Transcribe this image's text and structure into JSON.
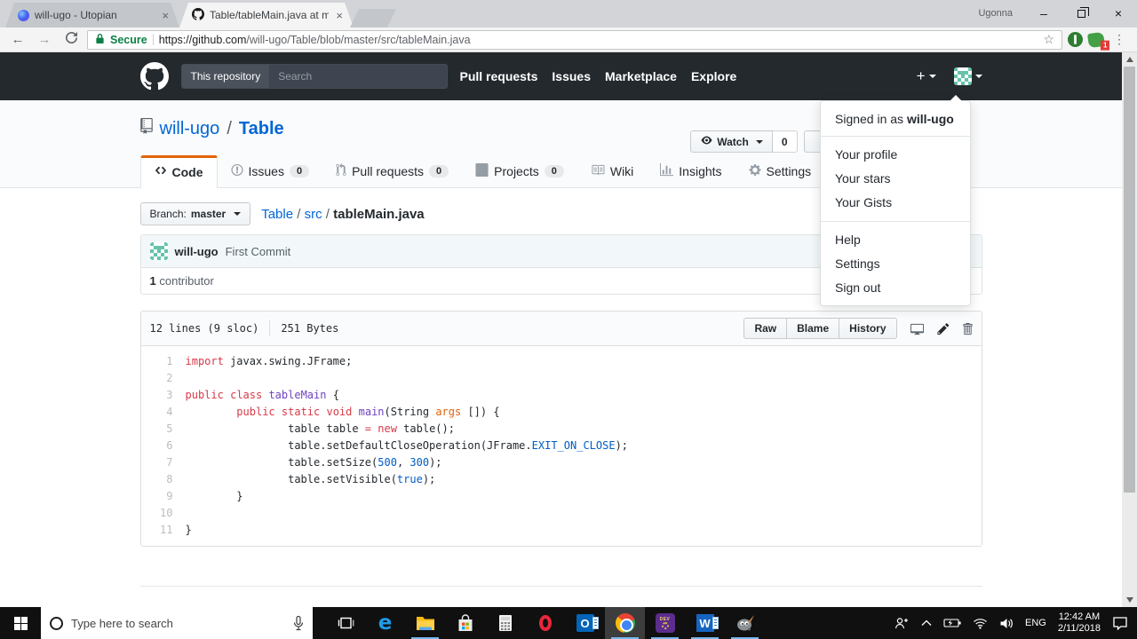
{
  "browser": {
    "profile": "Ugonna",
    "tabs": [
      {
        "title": "will-ugo - Utopian",
        "icon": "utopian-favicon"
      },
      {
        "title": "Table/tableMain.java at m",
        "icon": "github-favicon"
      }
    ],
    "url": {
      "secure_label": "Secure",
      "host": "https://github.com",
      "path": "/will-ugo/Table/blob/master/src/tableMain.java"
    },
    "extension_badge": "1"
  },
  "github": {
    "header": {
      "search_scope": "This repository",
      "search_placeholder": "Search",
      "nav": [
        "Pull requests",
        "Issues",
        "Marketplace",
        "Explore"
      ]
    },
    "repo": {
      "owner": "will-ugo",
      "name": "Table",
      "watch_label": "Watch",
      "watch_count": "0"
    },
    "tabs": [
      {
        "label": "Code",
        "icon": "code-icon",
        "count": null,
        "active": true
      },
      {
        "label": "Issues",
        "icon": "issue-icon",
        "count": "0",
        "active": false
      },
      {
        "label": "Pull requests",
        "icon": "pull-request-icon",
        "count": "0",
        "active": false
      },
      {
        "label": "Projects",
        "icon": "projects-icon",
        "count": "0",
        "active": false
      },
      {
        "label": "Wiki",
        "icon": "wiki-icon",
        "count": null,
        "active": false
      },
      {
        "label": "Insights",
        "icon": "insights-icon",
        "count": null,
        "active": false
      },
      {
        "label": "Settings",
        "icon": "gear-icon",
        "count": null,
        "active": false
      }
    ],
    "breadcrumb": {
      "branch_prefix": "Branch:",
      "branch": "master",
      "links": [
        "Table",
        "src"
      ],
      "current": "tableMain.java"
    },
    "commit": {
      "author": "will-ugo",
      "message": "First Commit",
      "contributors_count": "1",
      "contributors_label": "contributor"
    },
    "file": {
      "lines_info": "12 lines (9 sloc)",
      "size_info": "251 Bytes",
      "actions": [
        "Raw",
        "Blame",
        "History"
      ],
      "icon_actions": [
        "open-in-desktop-icon",
        "edit-icon",
        "delete-icon"
      ]
    },
    "code": [
      {
        "n": 1,
        "segs": [
          [
            "k",
            "import"
          ],
          [
            "p",
            " javax.swing.JFrame;"
          ]
        ]
      },
      {
        "n": 2,
        "segs": []
      },
      {
        "n": 3,
        "segs": [
          [
            "k",
            "public"
          ],
          [
            "p",
            " "
          ],
          [
            "k",
            "class"
          ],
          [
            "p",
            " "
          ],
          [
            "e",
            "tableMain"
          ],
          [
            "p",
            " {"
          ]
        ]
      },
      {
        "n": 4,
        "segs": [
          [
            "p",
            "        "
          ],
          [
            "k",
            "public"
          ],
          [
            "p",
            " "
          ],
          [
            "k",
            "static"
          ],
          [
            "p",
            " "
          ],
          [
            "k",
            "void"
          ],
          [
            "p",
            " "
          ],
          [
            "e",
            "main"
          ],
          [
            "p",
            "(String "
          ],
          [
            "o",
            "args"
          ],
          [
            "p",
            " []) {"
          ]
        ]
      },
      {
        "n": 5,
        "segs": [
          [
            "p",
            "                table table "
          ],
          [
            "k",
            "="
          ],
          [
            "p",
            " "
          ],
          [
            "k",
            "new"
          ],
          [
            "p",
            " table();"
          ]
        ]
      },
      {
        "n": 6,
        "segs": [
          [
            "p",
            "                table.setDefaultCloseOperation(JFrame."
          ],
          [
            "c",
            "EXIT_ON_CLOSE"
          ],
          [
            "p",
            ");"
          ]
        ]
      },
      {
        "n": 7,
        "segs": [
          [
            "p",
            "                table.setSize("
          ],
          [
            "c",
            "500"
          ],
          [
            "p",
            ", "
          ],
          [
            "c",
            "300"
          ],
          [
            "p",
            ");"
          ]
        ]
      },
      {
        "n": 8,
        "segs": [
          [
            "p",
            "                table.setVisible("
          ],
          [
            "c",
            "true"
          ],
          [
            "p",
            ");"
          ]
        ]
      },
      {
        "n": 9,
        "segs": [
          [
            "p",
            "        }"
          ]
        ]
      },
      {
        "n": 10,
        "segs": []
      },
      {
        "n": 11,
        "segs": [
          [
            "p",
            "}"
          ]
        ]
      }
    ],
    "user_menu": {
      "signed_in": "Signed in as",
      "username": "will-ugo",
      "items_1": [
        "Your profile",
        "Your stars",
        "Your Gists"
      ],
      "items_2": [
        "Help",
        "Settings",
        "Sign out"
      ]
    }
  },
  "taskbar": {
    "search_placeholder": "Type here to search",
    "apps": [
      {
        "name": "task-view-icon",
        "open": false,
        "active": false
      },
      {
        "name": "edge-icon",
        "open": false,
        "active": false
      },
      {
        "name": "file-explorer-icon",
        "open": true,
        "active": false
      },
      {
        "name": "store-icon",
        "open": false,
        "active": false
      },
      {
        "name": "calculator-icon",
        "open": false,
        "active": false
      },
      {
        "name": "opera-icon",
        "open": false,
        "active": false
      },
      {
        "name": "outlook-icon",
        "open": false,
        "active": false
      },
      {
        "name": "chrome-icon",
        "open": true,
        "active": true
      },
      {
        "name": "dev-cpp-icon",
        "open": true,
        "active": false
      },
      {
        "name": "word-icon",
        "open": true,
        "active": false
      },
      {
        "name": "gimp-icon",
        "open": true,
        "active": false
      }
    ],
    "tray": {
      "language": "ENG",
      "time": "12:42 AM",
      "date": "2/11/2018"
    }
  },
  "colors": {
    "gh_header": "#24292e",
    "link_blue": "#0366d6",
    "tab_active_border": "#e36209",
    "secure_green": "#0b8043",
    "avatar_teal": "#64c3a9",
    "taskbar_underline": "#76b9ed",
    "syntax_keyword": "#d73a49",
    "syntax_entity": "#6f42c1",
    "syntax_constant": "#005cc5",
    "syntax_variable": "#e36209"
  }
}
